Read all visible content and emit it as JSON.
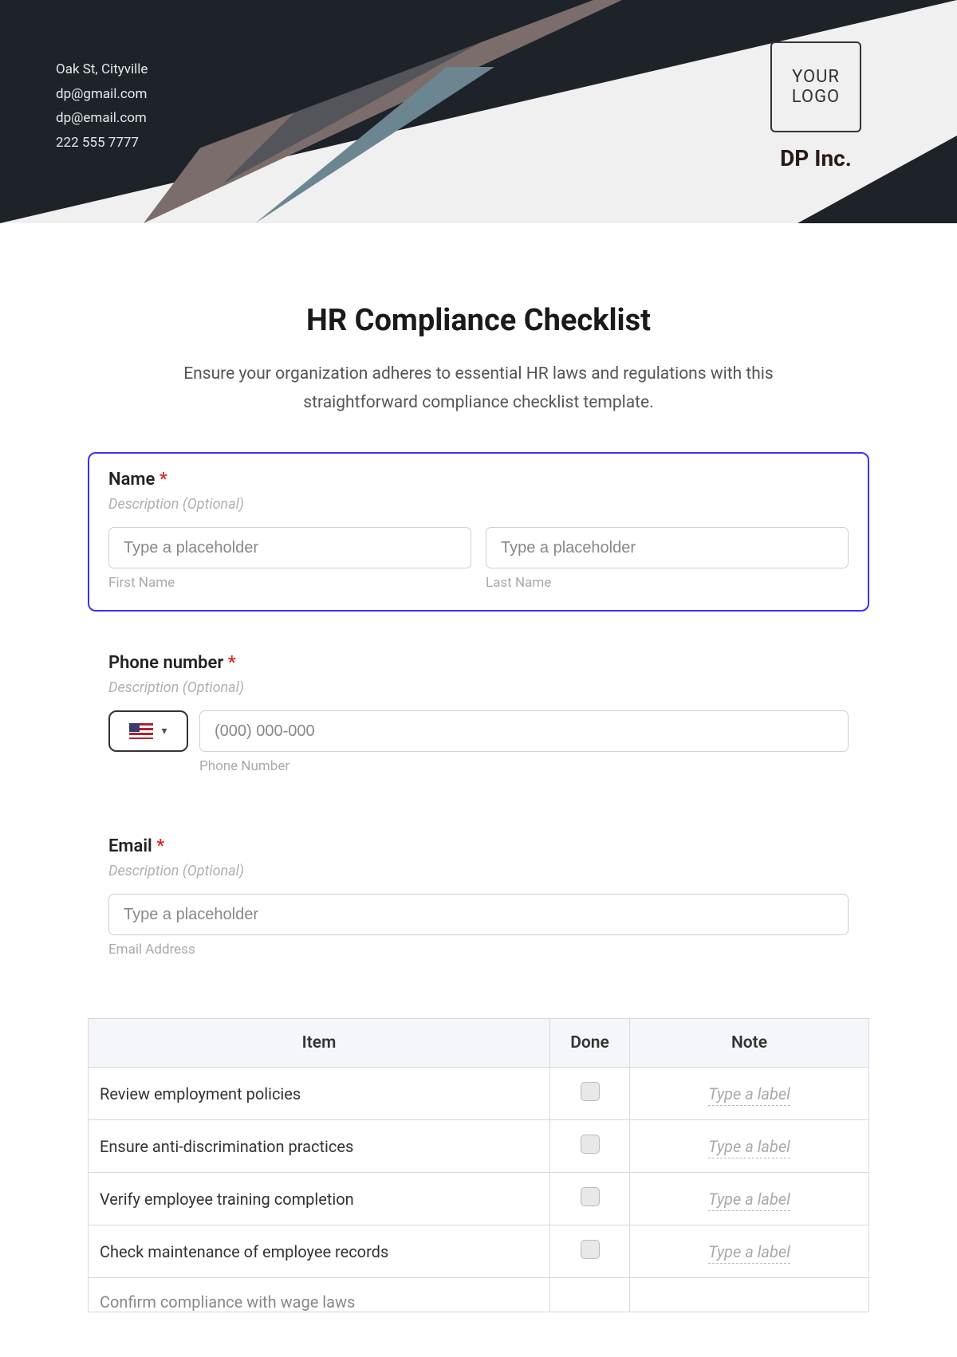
{
  "header": {
    "contact": {
      "address": "Oak St, Cityville",
      "email1": "dp@gmail.com",
      "email2": "dp@email.com",
      "phone": "222 555 7777"
    },
    "logo": {
      "line1": "YOUR",
      "line2": "LOGO"
    },
    "company": "DP Inc."
  },
  "title": "HR Compliance Checklist",
  "subtitle": "Ensure your organization adheres to essential HR laws and regulations with this straightforward compliance checklist template.",
  "fields": {
    "name": {
      "label": "Name",
      "desc": "Description (Optional)",
      "first_placeholder": "Type a placeholder",
      "first_sublabel": "First Name",
      "last_placeholder": "Type a placeholder",
      "last_sublabel": "Last Name"
    },
    "phone": {
      "label": "Phone number",
      "desc": "Description (Optional)",
      "placeholder": "(000) 000-000",
      "sublabel": "Phone Number"
    },
    "email": {
      "label": "Email",
      "desc": "Description (Optional)",
      "placeholder": "Type a placeholder",
      "sublabel": "Email Address"
    }
  },
  "table": {
    "headers": {
      "item": "Item",
      "done": "Done",
      "note": "Note"
    },
    "note_placeholder": "Type a label",
    "rows": [
      {
        "item": "Review employment policies"
      },
      {
        "item": "Ensure anti-discrimination practices"
      },
      {
        "item": "Verify employee training completion"
      },
      {
        "item": "Check maintenance of employee records"
      }
    ],
    "cutoff_item": "Confirm compliance with wage laws"
  }
}
